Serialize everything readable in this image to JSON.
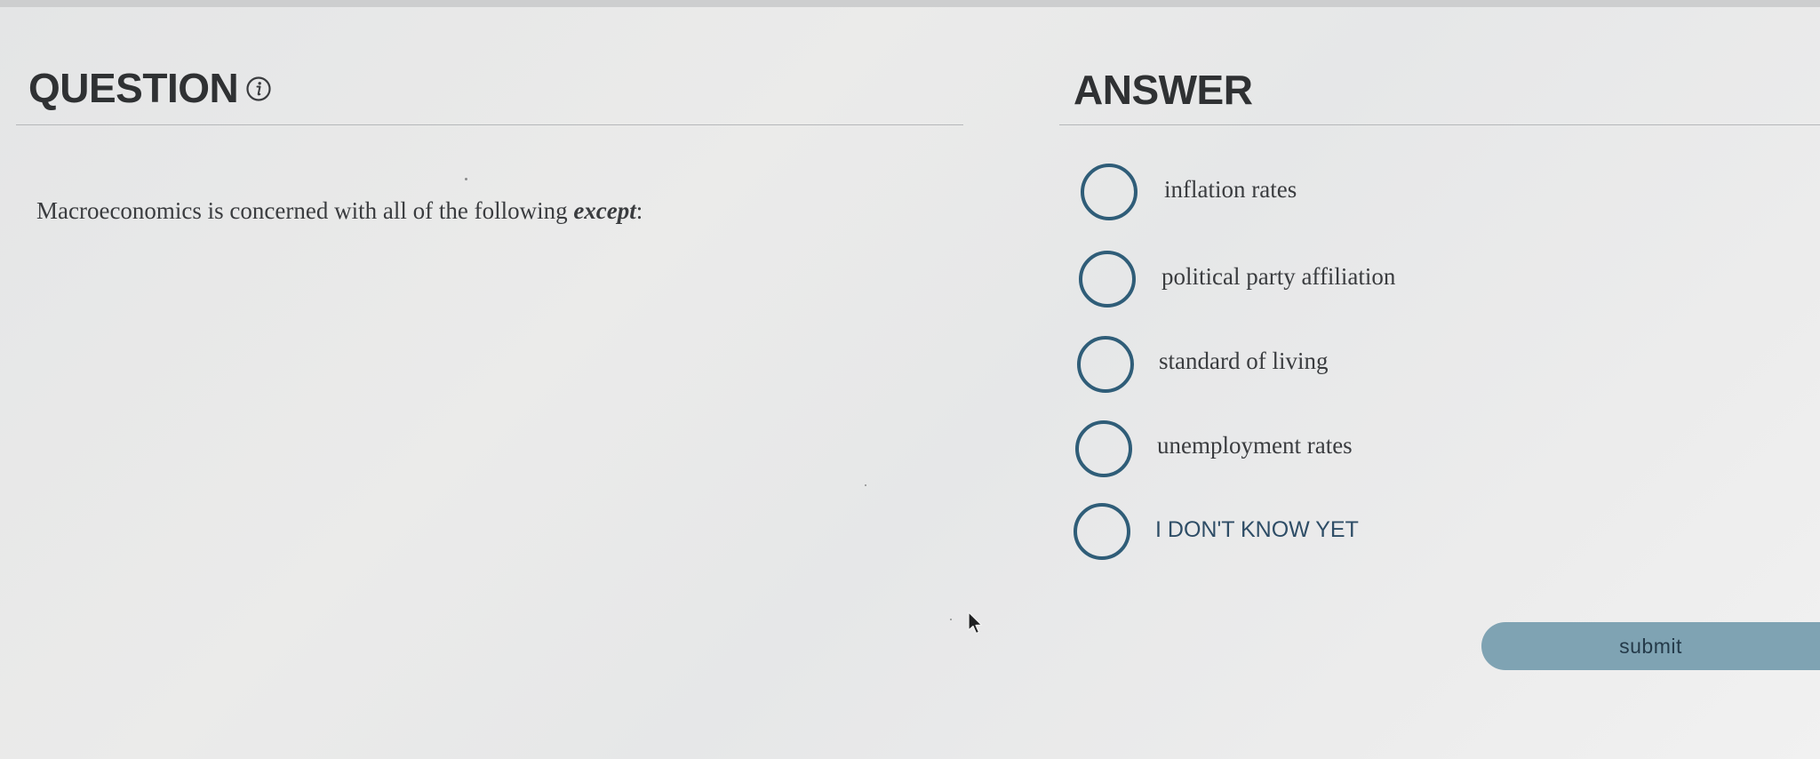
{
  "question": {
    "heading": "QUESTION",
    "text_main": "Macroeconomics is concerned with all of the following ",
    "text_emphasis": "except",
    "text_end": ":"
  },
  "answer": {
    "heading": "ANSWER",
    "options": [
      {
        "label": "inflation rates"
      },
      {
        "label": "political party affiliation"
      },
      {
        "label": "standard of living"
      },
      {
        "label": "unemployment rates"
      },
      {
        "label": "I DON'T KNOW YET"
      }
    ]
  },
  "actions": {
    "submit_label": "submit"
  },
  "icons": {
    "info": "info-icon",
    "radio": "radio-circle",
    "cursor": "mouse-pointer-icon"
  },
  "colors": {
    "heading": "#2f3133",
    "radio_border": "#2f5d78",
    "submit_bg": "#7fa3b3",
    "idk_text": "#2e4d66"
  }
}
